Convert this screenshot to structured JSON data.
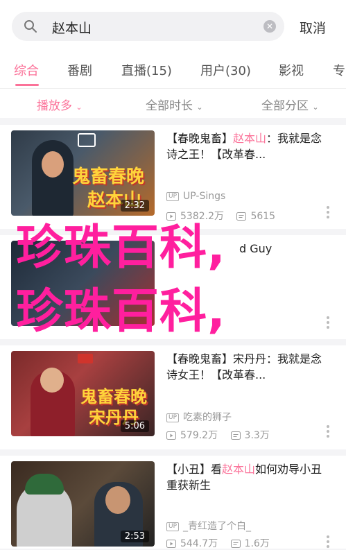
{
  "search": {
    "query": "赵本山",
    "cancel_label": "取消"
  },
  "tabs": [
    "综合",
    "番剧",
    "直播(15)",
    "用户(30)",
    "影视",
    "专"
  ],
  "filters": [
    "播放多",
    "全部时长",
    "全部分区"
  ],
  "videos": [
    {
      "title_tag": "【春晚鬼畜】",
      "title_hl": "赵本山",
      "title_rest": "：我就是念诗之王！【改革春...",
      "uploader": "UP-Sings",
      "plays": "5382.2万",
      "comments": "5615",
      "duration": "2:32",
      "thumb_caption_1": "鬼畜春晚",
      "thumb_caption_2": "赵本山"
    },
    {
      "title_tag": "",
      "title_hl": "",
      "title_rest": "d Guy",
      "uploader": "",
      "plays": "",
      "comments": "",
      "duration": ""
    },
    {
      "title_tag": "【春晚鬼畜】",
      "title_hl": "",
      "title_rest": "宋丹丹：我就是念诗女王！【改革春...",
      "uploader": "吃素的狮子",
      "plays": "579.2万",
      "comments": "3.3万",
      "duration": "5:06",
      "thumb_caption_1": "鬼畜春晚",
      "thumb_caption_2": "宋丹丹"
    },
    {
      "title_tag": "【小丑】看",
      "title_hl": "赵本山",
      "title_rest": "如何劝导小丑重获新生",
      "uploader": "_青红造了个白_",
      "plays": "544.7万",
      "comments": "1.6万",
      "duration": "2:53"
    }
  ],
  "watermark": {
    "line1": "珍珠百科,",
    "line2": "珍珠百科,"
  },
  "colors": {
    "accent": "#fb7299",
    "watermark": "#ff1f9e"
  }
}
